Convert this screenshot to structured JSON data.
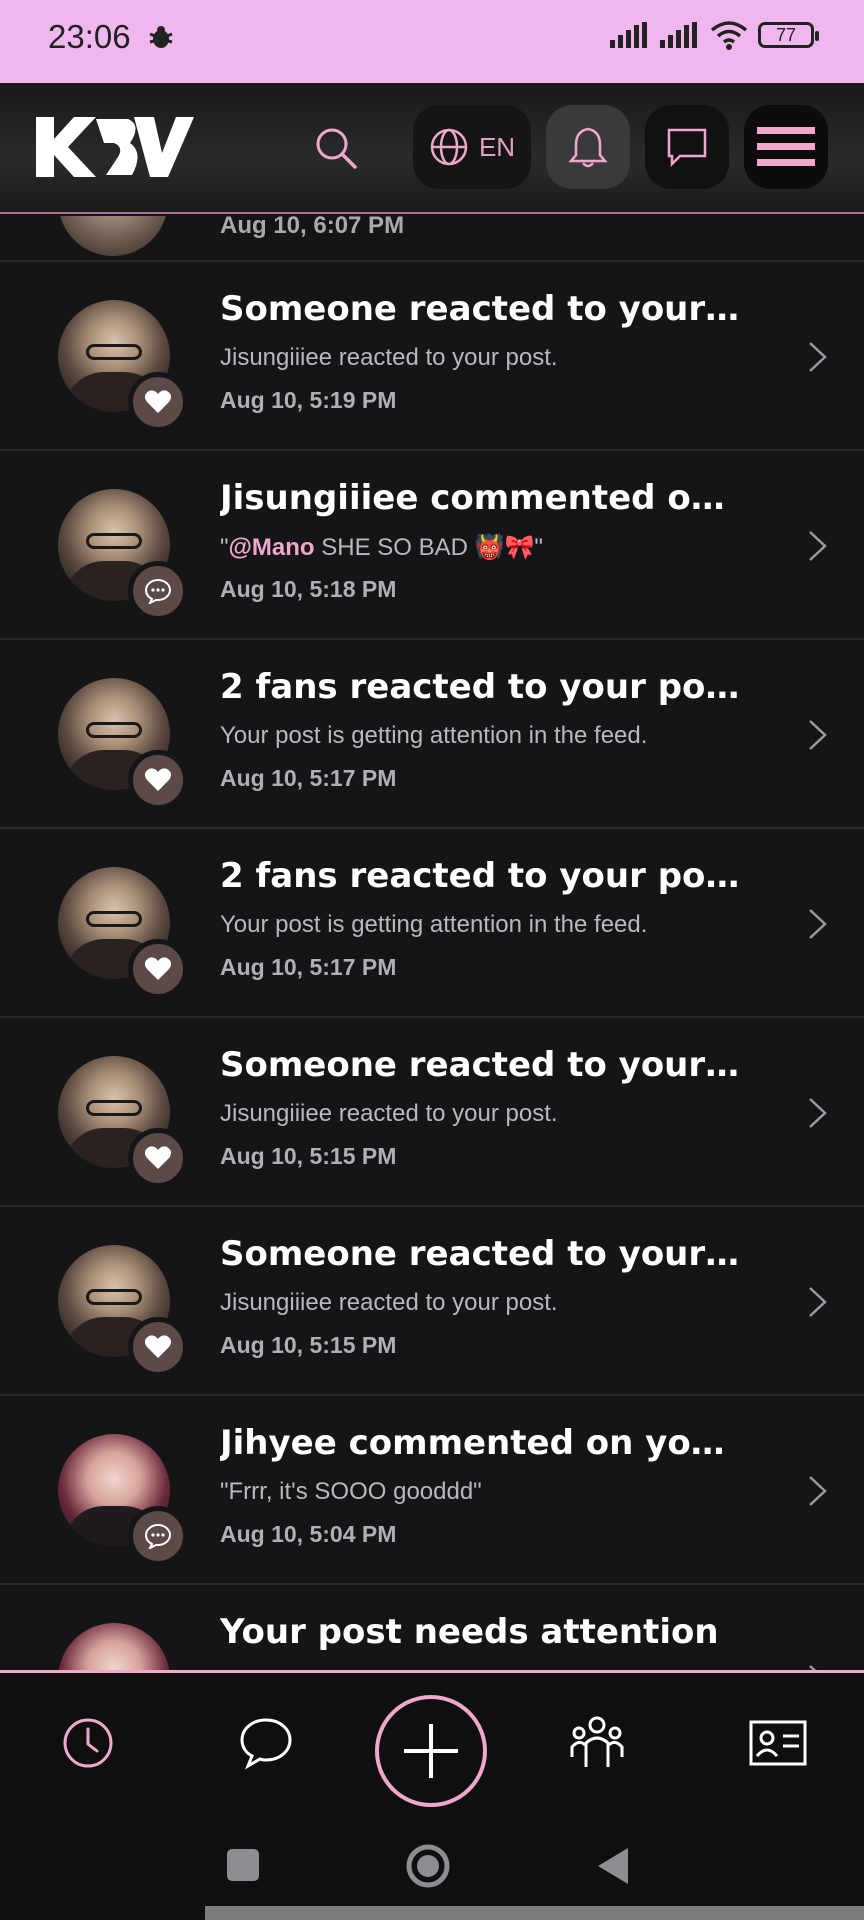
{
  "status_bar": {
    "time": "23:06",
    "battery": "77"
  },
  "header": {
    "language": "EN"
  },
  "partial_top_time": "Aug 10, 6:07 PM",
  "notifications": [
    {
      "title": "Someone reacted to your p...",
      "subtitle": "Jisungiiiee reacted to your post.",
      "time": "Aug 10, 5:19 PM",
      "badge": "heart",
      "avatar": "main"
    },
    {
      "title": "Jisungiiiee commented on y...",
      "subtitle_prefix": "\"",
      "mention": "@Mano",
      "subtitle": " SHE SO BAD 👹🎀\"",
      "time": "Aug 10, 5:18 PM",
      "badge": "comment",
      "avatar": "main"
    },
    {
      "title": "2 fans reacted to your post",
      "subtitle": "Your post is getting attention in the feed.",
      "time": "Aug 10, 5:17 PM",
      "badge": "heart",
      "avatar": "main"
    },
    {
      "title": "2 fans reacted to your post",
      "subtitle": "Your post is getting attention in the feed.",
      "time": "Aug 10, 5:17 PM",
      "badge": "heart",
      "avatar": "main"
    },
    {
      "title": "Someone reacted to your p...",
      "subtitle": "Jisungiiiee reacted to your post.",
      "time": "Aug 10, 5:15 PM",
      "badge": "heart",
      "avatar": "main"
    },
    {
      "title": "Someone reacted to your p...",
      "subtitle": "Jisungiiiee reacted to your post.",
      "time": "Aug 10, 5:15 PM",
      "badge": "heart",
      "avatar": "main"
    },
    {
      "title": "Jihyee commented on your ...",
      "subtitle": "\"Frrr, it's SOOO gooddd\"",
      "time": "Aug 10, 5:04 PM",
      "badge": "comment",
      "avatar": "alt"
    },
    {
      "title": "Your post needs attention",
      "subtitle": "",
      "time": "",
      "badge": "",
      "avatar": "alt"
    }
  ],
  "colors": {
    "accent": "#f0a7cc",
    "status_bar": "#f0b7ee",
    "background": "#151517"
  }
}
